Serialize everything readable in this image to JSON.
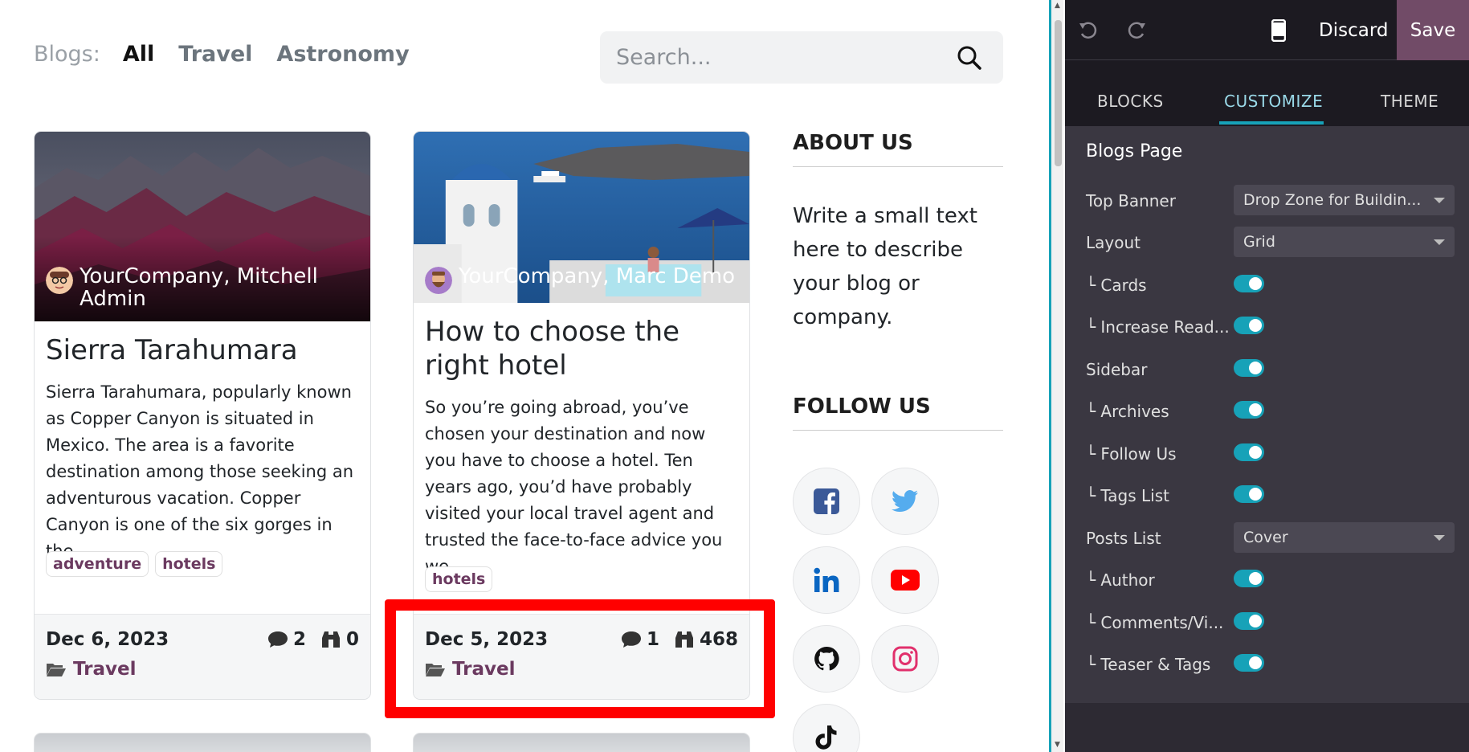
{
  "blog_nav": {
    "label": "Blogs:",
    "items": [
      "All",
      "Travel",
      "Astronomy"
    ]
  },
  "search": {
    "placeholder": "Search..."
  },
  "posts": [
    {
      "author": "YourCompany, Mitchell Admin",
      "title": "Sierra Tarahumara",
      "teaser": "Sierra Tarahumara, popularly known as Copper Canyon is situated in Mexico. The area is a favorite destination among those seeking an adventurous vacation. Copper Canyon is one of the six gorges in the...",
      "tags": [
        "adventure",
        "hotels"
      ],
      "date": "Dec 6, 2023",
      "comments": "2",
      "views": "0",
      "category": "Travel"
    },
    {
      "author": "YourCompany, Marc Demo",
      "title": "How to choose the right hotel",
      "teaser": "So you’re going abroad, you’ve chosen your destination and now you have to choose a hotel. Ten years ago, you’d have probably visited your local travel agent and trusted the face-to-face advice you we...",
      "tags": [
        "hotels"
      ],
      "date": "Dec 5, 2023",
      "comments": "1",
      "views": "468",
      "category": "Travel"
    }
  ],
  "sidebar": {
    "about_title": "ABOUT US",
    "about_text": "Write a small text here to describe your blog or company.",
    "follow_title": "FOLLOW US",
    "social_icons": [
      "facebook-icon",
      "twitter-icon",
      "linkedin-icon",
      "youtube-icon",
      "github-icon",
      "instagram-icon",
      "tiktok-icon"
    ]
  },
  "editor": {
    "discard_label": "Discard",
    "save_label": "Save",
    "tabs": [
      "BLOCKS",
      "CUSTOMIZE",
      "THEME"
    ],
    "active_tab": "CUSTOMIZE",
    "section_title": "Blogs Page",
    "options": [
      {
        "label": "Top Banner",
        "type": "select",
        "value": "Drop Zone for Buildin..."
      },
      {
        "label": "Layout",
        "type": "select",
        "value": "Grid"
      },
      {
        "label": "└ Cards",
        "type": "toggle",
        "on": true
      },
      {
        "label": "└ Increase Read...",
        "type": "toggle",
        "on": true
      },
      {
        "label": "Sidebar",
        "type": "toggle",
        "on": true
      },
      {
        "label": "└ Archives",
        "type": "toggle",
        "on": true
      },
      {
        "label": "└ Follow Us",
        "type": "toggle",
        "on": true
      },
      {
        "label": "└ Tags List",
        "type": "toggle",
        "on": true
      },
      {
        "label": "Posts List",
        "type": "select",
        "value": "Cover"
      },
      {
        "label": "└ Author",
        "type": "toggle",
        "on": true
      },
      {
        "label": "└ Comments/Vi...",
        "type": "toggle",
        "on": true
      },
      {
        "label": "└ Teaser & Tags",
        "type": "toggle",
        "on": true
      }
    ]
  },
  "colors": {
    "accent": "#17a2b8",
    "brand": "#714b67",
    "tag_text": "#6b3a60",
    "highlight": "#ff0000"
  }
}
